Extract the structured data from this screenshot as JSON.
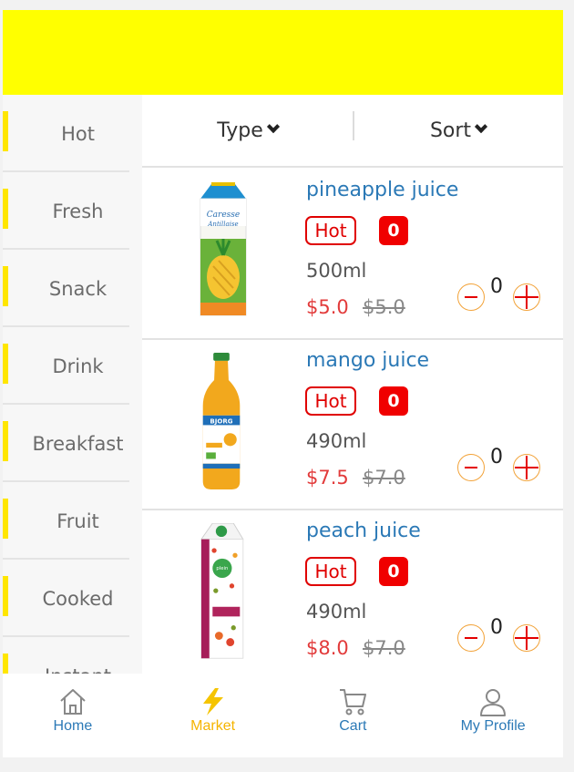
{
  "colors": {
    "banner": "#ffff00",
    "accent_yellow": "#ffe600",
    "link_blue": "#2b79b6",
    "price_red": "#e23b3b",
    "hot_red": "#e00000",
    "active_tab": "#f5b400"
  },
  "sidebar": {
    "items": [
      {
        "label": "Hot"
      },
      {
        "label": "Fresh"
      },
      {
        "label": "Snack"
      },
      {
        "label": "Drink"
      },
      {
        "label": "Breakfast"
      },
      {
        "label": "Fruit"
      },
      {
        "label": "Cooked"
      },
      {
        "label": "Instant"
      }
    ]
  },
  "filters": {
    "type_label": "Type",
    "sort_label": "Sort",
    "icon": "chevron-down-icon"
  },
  "products": [
    {
      "name": "pineapple juice",
      "tag": "Hot",
      "count": "0",
      "volume": "500ml",
      "price": "$5.0",
      "old_price": "$5.0",
      "qty": "0",
      "image": "pineapple-juice-carton"
    },
    {
      "name": "mango juice",
      "tag": "Hot",
      "count": "0",
      "volume": "490ml",
      "price": "$7.5",
      "old_price": "$7.0",
      "qty": "0",
      "image": "mango-juice-bottle"
    },
    {
      "name": "peach juice",
      "tag": "Hot",
      "count": "0",
      "volume": "490ml",
      "price": "$8.0",
      "old_price": "$7.0",
      "qty": "0",
      "image": "peach-juice-carton"
    }
  ],
  "tabbar": {
    "items": [
      {
        "label": "Home",
        "icon": "home-icon",
        "active": false
      },
      {
        "label": "Market",
        "icon": "lightning-icon",
        "active": true
      },
      {
        "label": "Cart",
        "icon": "cart-icon",
        "active": false
      },
      {
        "label": "My Profile",
        "icon": "profile-icon",
        "active": false
      }
    ]
  }
}
